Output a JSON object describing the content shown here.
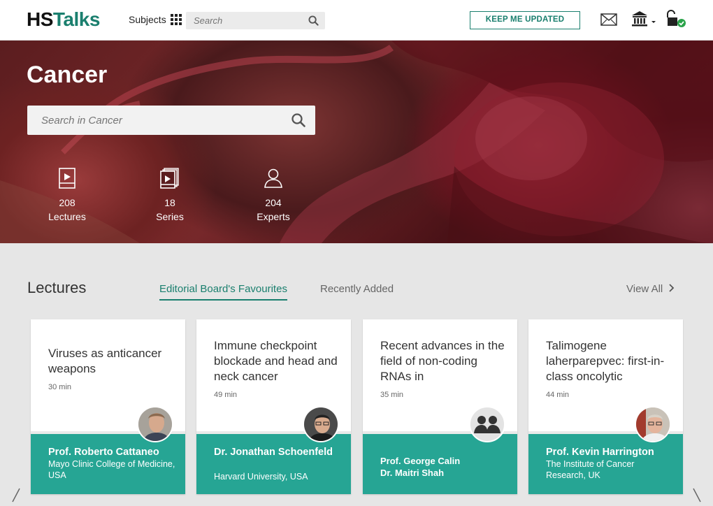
{
  "header": {
    "logo_hs": "HS",
    "logo_talks": "Talks",
    "subjects_label": "Subjects",
    "search_placeholder": "Search",
    "keep_updated": "KEEP ME UPDATED"
  },
  "hero": {
    "title": "Cancer",
    "search_placeholder": "Search in Cancer",
    "stats": [
      {
        "count": "208",
        "label": "Lectures",
        "icon": "lecture-icon"
      },
      {
        "count": "18",
        "label": "Series",
        "icon": "series-icon"
      },
      {
        "count": "204",
        "label": "Experts",
        "icon": "expert-icon"
      }
    ]
  },
  "lectures": {
    "title": "Lectures",
    "tabs": [
      "Editorial Board's Favourites",
      "Recently Added"
    ],
    "view_all": "View All",
    "cards": [
      {
        "title": "Viruses as anticancer weapons",
        "duration": "30 min",
        "speaker": "Prof. Roberto Cattaneo",
        "institution": "Mayo Clinic College of Medicine, USA"
      },
      {
        "title": "Immune checkpoint blockade and head and neck cancer",
        "duration": "49 min",
        "speaker": "Dr. Jonathan Schoenfeld",
        "institution": "Harvard University, USA"
      },
      {
        "title": "Recent advances in the field of non-coding RNAs in",
        "duration": "35 min",
        "speakers": [
          "Prof. George Calin",
          "Dr. Maitri Shah"
        ]
      },
      {
        "title": "Talimogene laherparepvec: first-in-class oncolytic",
        "duration": "44 min",
        "speaker": "Prof. Kevin Harrington",
        "institution": "The Institute of Cancer Research, UK"
      }
    ]
  },
  "colors": {
    "brand": "#1a7f6e",
    "card_footer": "#26a594"
  }
}
